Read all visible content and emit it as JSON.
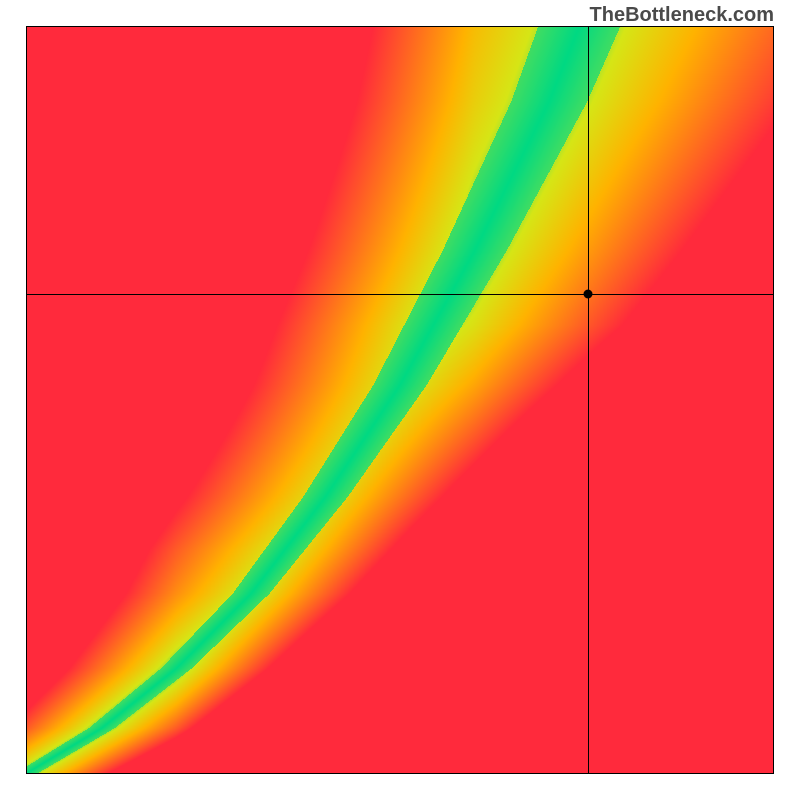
{
  "watermark": "TheBottleneck.com",
  "chart_data": {
    "type": "heatmap",
    "title": "",
    "xlabel": "",
    "ylabel": "",
    "xlim": [
      0,
      1
    ],
    "ylim": [
      0,
      1
    ],
    "grid": false,
    "legend": false,
    "colors": {
      "optimal": "#00d983",
      "near": "#d6e616",
      "mid": "#ffb300",
      "far": "#ff2a3c"
    },
    "optimal_curve_points": [
      [
        0.0,
        0.0
      ],
      [
        0.1,
        0.06
      ],
      [
        0.2,
        0.14
      ],
      [
        0.3,
        0.24
      ],
      [
        0.4,
        0.37
      ],
      [
        0.5,
        0.52
      ],
      [
        0.55,
        0.61
      ],
      [
        0.6,
        0.7
      ],
      [
        0.65,
        0.8
      ],
      [
        0.7,
        0.9
      ],
      [
        0.74,
        1.0
      ]
    ],
    "selected_point": {
      "x": 0.752,
      "y": 0.642
    },
    "band_half_width_at_y0": 0.015,
    "band_half_width_at_y1": 0.055
  }
}
